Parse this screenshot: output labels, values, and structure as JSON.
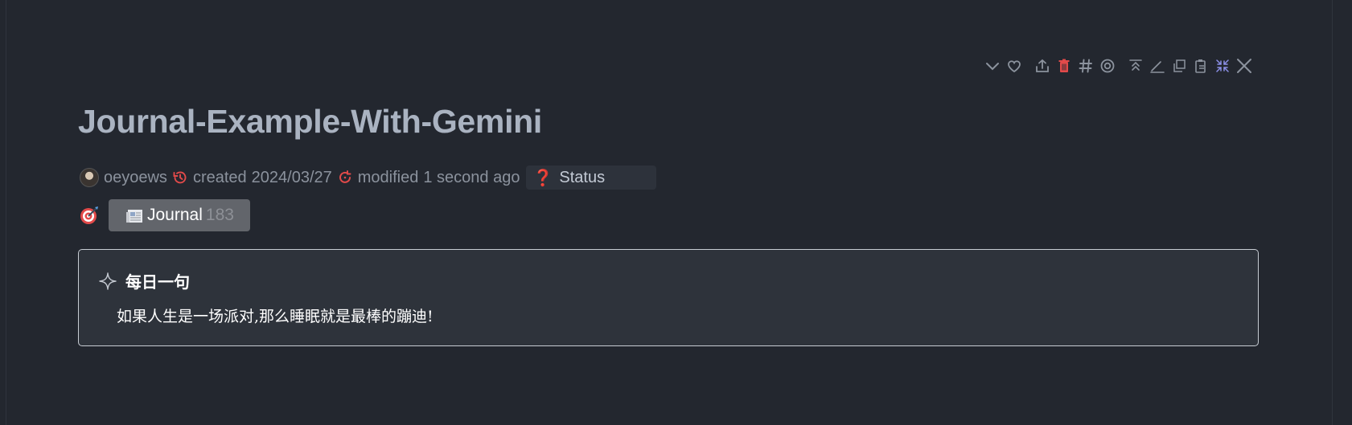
{
  "page": {
    "title": "Journal-Example-With-Gemini"
  },
  "toolbar": {
    "icons": [
      "chevron-down-icon",
      "heart-icon",
      "share-icon",
      "trash-icon",
      "hash-icon",
      "target-icon",
      "move-to-top-icon",
      "edit-icon",
      "duplicate-icon",
      "clipboard-icon",
      "collapse-icon",
      "close-icon"
    ]
  },
  "meta": {
    "author": "oeyoews",
    "created_label": "created",
    "created_date": "2024/03/27",
    "modified_label": "modified",
    "modified_relative": "1 second ago",
    "status_icon": "❓",
    "status_label": "Status"
  },
  "tags": [
    {
      "label": "Journal",
      "count": "183"
    }
  ],
  "callout": {
    "title": "每日一句",
    "body": "如果人生是一场派对,那么睡眠就是最棒的蹦迪!"
  },
  "colors": {
    "background": "#23272f",
    "title": "#aab3c1",
    "accent_red": "#e24a4a",
    "tag_bg": "#62656b",
    "callout_bg": "#2e333b"
  }
}
